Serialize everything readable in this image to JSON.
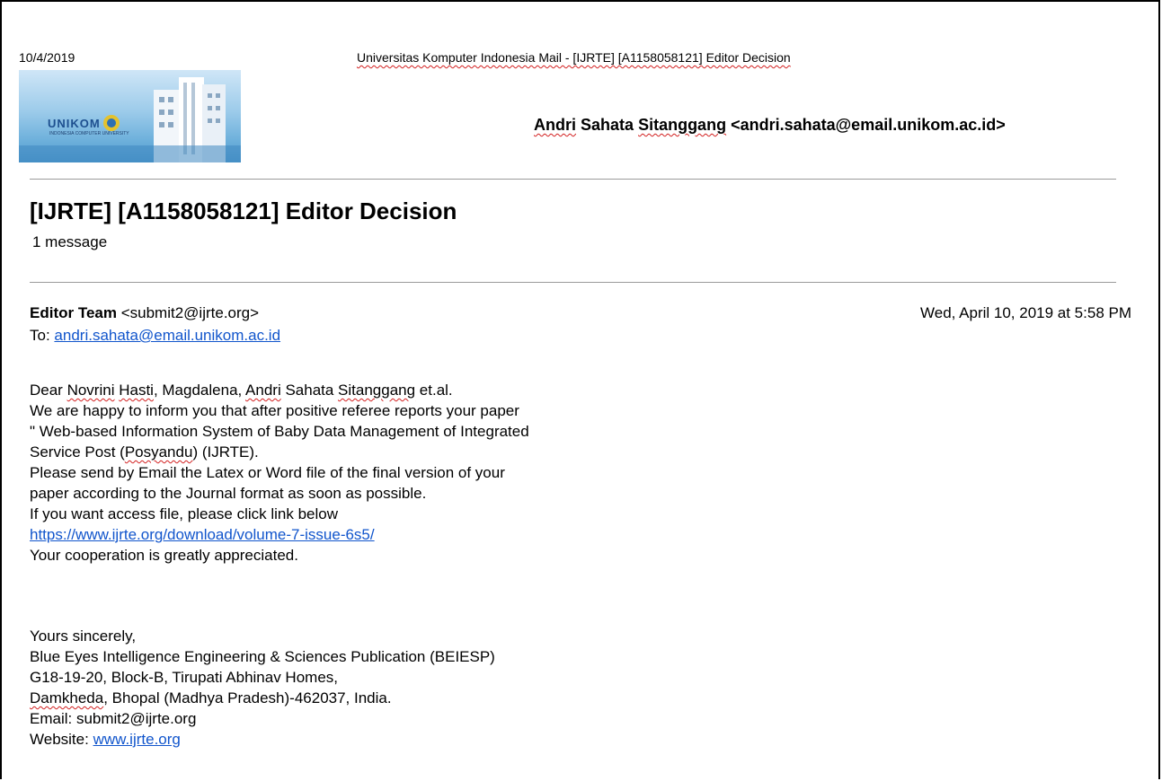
{
  "print_header": {
    "date": "10/4/2019",
    "title": "Universitas Komputer Indonesia Mail - [IJRTE] [A1158058121] Editor Decision"
  },
  "logo": {
    "brand": "UNIKOM",
    "sub": "INDONESIA COMPUTER UNIVERSITY"
  },
  "account": {
    "name_part1": "Andri",
    "name_part2": "Sahata",
    "name_part3": "Sitanggang",
    "email": "<andri.sahata@email.unikom.ac.id>"
  },
  "thread": {
    "subject": "[IJRTE] [A1158058121] Editor Decision",
    "count": "1 message"
  },
  "message": {
    "sender_name": "Editor Team",
    "sender_email": "<submit2@ijrte.org>",
    "date": "Wed, April 10, 2019 at 5:58 PM",
    "to_label": "To:",
    "to_address": "andri.sahata@email.unikom.ac.id",
    "greeting": {
      "a": "Dear ",
      "b": "Novrini",
      "c": " ",
      "d": "Hasti",
      "e": ", Magdalena, ",
      "f": "Andri",
      "g": " Sahata ",
      "h": "Sitanggang",
      "i": " et.al."
    },
    "line2": "We are happy to inform you that after positive referee reports your paper",
    "line3": "\" Web-based Information System of Baby Data Management of Integrated",
    "line4": {
      "a": "Service Post (",
      "b": "Posyandu",
      "c": ") (IJRTE)."
    },
    "line5": "Please send by Email the Latex or Word file of the final version of your",
    "line6": "paper according to the Journal format as soon as possible.",
    "line7": "If you want access file, please click link below",
    "link": "https://www.ijrte.org/download/volume-7-issue-6s5/",
    "line9": "Your cooperation is greatly appreciated.",
    "closing": "Yours sincerely,",
    "sig1": "Blue Eyes Intelligence Engineering & Sciences Publication (BEIESP)",
    "sig2": "G18-19-20, Block-B, Tirupati Abhinav Homes,",
    "sig3": {
      "a": "Damkheda",
      "b": ", Bhopal (Madhya Pradesh)-462037, India."
    },
    "email_line": "Email: submit2@ijrte.org",
    "website_label": "Website: ",
    "website": "www.ijrte.org"
  }
}
